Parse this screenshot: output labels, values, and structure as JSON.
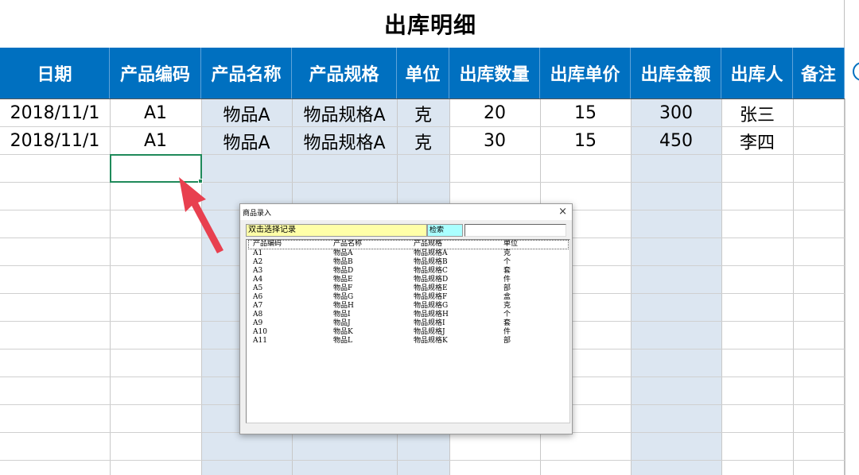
{
  "sheet": {
    "title": "出库明细",
    "headers": [
      "日期",
      "产品编码",
      "产品名称",
      "产品规格",
      "单位",
      "出库数量",
      "出库单价",
      "出库金额",
      "出库人",
      "备注"
    ],
    "rows": [
      [
        "2018/11/1",
        "A1",
        "物品A",
        "物品规格A",
        "克",
        "20",
        "15",
        "300",
        "张三",
        ""
      ],
      [
        "2018/11/1",
        "A1",
        "物品A",
        "物品规格A",
        "克",
        "30",
        "15",
        "450",
        "李四",
        ""
      ]
    ],
    "colors": {
      "header_bg": "#0070c0",
      "shaded_column": "#dce6f1",
      "selection": "#1f8a5a",
      "arrow": "#e8404f"
    }
  },
  "dialog": {
    "title": "商品录入",
    "close_glyph": "×",
    "hint": "双击选择记录",
    "search_label": "检索",
    "search_value": "",
    "columns": [
      "产品编码",
      "产品名称",
      "产品规格",
      "单位"
    ],
    "items": [
      [
        "A1",
        "物品A",
        "物品规格A",
        "克"
      ],
      [
        "A2",
        "物品B",
        "物品规格B",
        "个"
      ],
      [
        "A3",
        "物品D",
        "物品规格C",
        "套"
      ],
      [
        "A4",
        "物品E",
        "物品规格D",
        "件"
      ],
      [
        "A5",
        "物品F",
        "物品规格E",
        "部"
      ],
      [
        "A6",
        "物品G",
        "物品规格F",
        "盒"
      ],
      [
        "A7",
        "物品H",
        "物品规格G",
        "克"
      ],
      [
        "A8",
        "物品I",
        "物品规格H",
        "个"
      ],
      [
        "A9",
        "物品J",
        "物品规格I",
        "套"
      ],
      [
        "A10",
        "物品K",
        "物品规格J",
        "件"
      ],
      [
        "A11",
        "物品L",
        "物品规格K",
        "部"
      ]
    ]
  }
}
